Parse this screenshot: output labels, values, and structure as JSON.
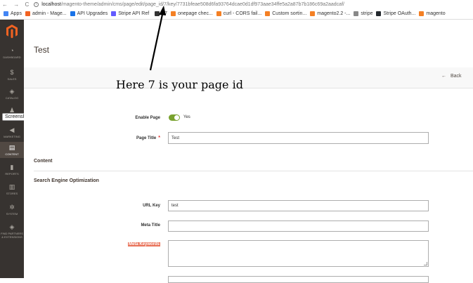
{
  "browser": {
    "nav_glyphs": "← → C",
    "info_glyph": "i",
    "url_host": "localhost",
    "url_path": "/magento-theme/admin/cms/page/edit/page_id/7/key/7731bfeae508d6fa93764dcae0d1df973aae34ffe5a2a87b7b186c69a2aadcaf/",
    "bookmarks": [
      {
        "label": "Apps",
        "color": "#4285f4"
      },
      {
        "label": "admin - Mage...",
        "color": "#f26322"
      },
      {
        "label": "API Upgrades",
        "color": "#1a73e8"
      },
      {
        "label": "Stripe API Ref",
        "color": "#635bff"
      },
      {
        "label": "17",
        "color": "#333333"
      },
      {
        "label": "onepage chec...",
        "color": "#f48024"
      },
      {
        "label": "curl - CORS fail...",
        "color": "#f48024"
      },
      {
        "label": "Custom sortin...",
        "color": "#f48024"
      },
      {
        "label": "magento2.2 -...",
        "color": "#f48024"
      },
      {
        "label": "stripe",
        "color": "#888888"
      },
      {
        "label": "Stripe OAuth...",
        "color": "#24292e"
      },
      {
        "label": "magento",
        "color": "#f48024"
      }
    ]
  },
  "sidebar": {
    "items": [
      {
        "label": "DASHBOARD",
        "icon": "dashboard-icon",
        "glyph": "◔"
      },
      {
        "label": "SALES",
        "icon": "dollar-icon",
        "glyph": "$"
      },
      {
        "label": "CATALOG",
        "icon": "cube-icon",
        "glyph": "◈"
      },
      {
        "label": "CUSTOMERS",
        "icon": "person-icon",
        "glyph": "♟"
      },
      {
        "label": "MARKETING",
        "icon": "megaphone-icon",
        "glyph": "◀"
      },
      {
        "label": "CONTENT",
        "icon": "content-icon",
        "glyph": "▤"
      },
      {
        "label": "REPORTS",
        "icon": "bar-chart-icon",
        "glyph": "▮"
      },
      {
        "label": "STORES",
        "icon": "store-icon",
        "glyph": "▥"
      },
      {
        "label": "SYSTEM",
        "icon": "gear-icon",
        "glyph": "✲"
      },
      {
        "label": "FIND PARTNERS & EXTENSIONS",
        "icon": "partners-icon",
        "glyph": "◈"
      }
    ],
    "tooltip": "Screenshot"
  },
  "page": {
    "title": "Test",
    "back_label": "Back",
    "back_glyph": "←"
  },
  "annotation": "Here 7 is your page id",
  "form": {
    "enable_page_label": "Enable Page",
    "enable_page_value": "Yes",
    "page_title_label": "Page Title",
    "required_mark": "*",
    "page_title_value": "Test",
    "content_section": "Content",
    "seo_section": "Search Engine Optimization",
    "url_key_label": "URL Key",
    "url_key_value": "test",
    "meta_title_label": "Meta Title",
    "meta_title_value": "",
    "meta_keywords_label": "Meta Keywords"
  },
  "colors": {
    "sidebar_bg": "#373330",
    "magento_orange": "#f26322",
    "toggle_on": "#79a22e",
    "highlight": "#e9735a"
  }
}
